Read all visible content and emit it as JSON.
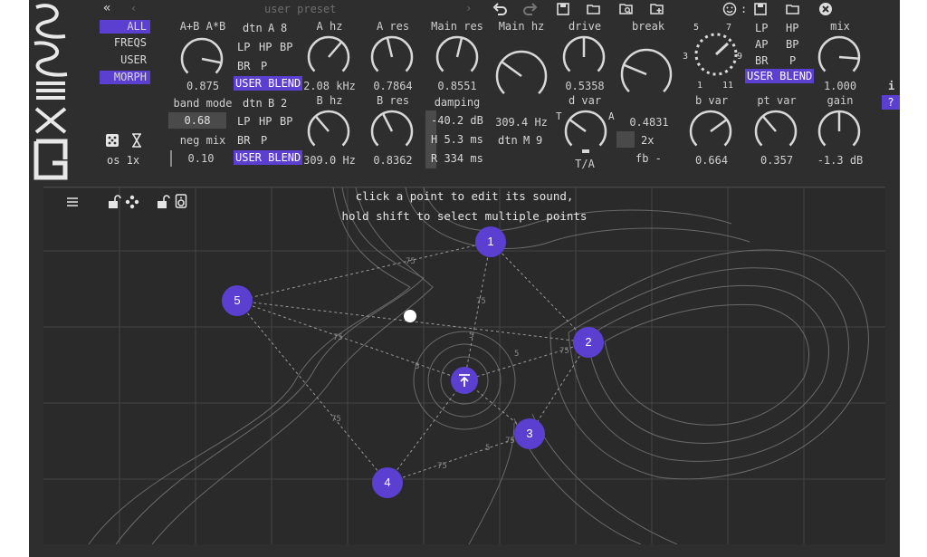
{
  "toolbar": {
    "preset_name": "user preset",
    "icons": [
      "double-chevron-left-icon",
      "chevron-left-icon",
      "chevron-right-icon",
      "undo-icon",
      "redo-icon",
      "save-icon",
      "folder-open-icon",
      "browse-presets-icon",
      "new-preset-icon",
      "smiley-icon",
      "save-icon",
      "folder-open-icon",
      "close-circle-icon"
    ],
    "smiley_sep": ":"
  },
  "modes": {
    "all": "ALL",
    "freqs": "FREQS",
    "user": "USER",
    "morph": "MORPH",
    "selected": "MORPH"
  },
  "osc": {
    "oversample": "os 1x",
    "icons": [
      "dice-icon",
      "hourglass-icon"
    ]
  },
  "blend": {
    "title": "A+B A*B",
    "value": "0.875",
    "band_mode_label": "band mode",
    "band_mode_value": "0.68",
    "neg_mix_label": "neg mix",
    "neg_mix_value": "0.10",
    "knob": 0.875
  },
  "filter_a": {
    "dtn": "dtn",
    "dtn_letter": "A",
    "dtn_value": "8",
    "types": [
      "LP",
      "HP",
      "BP",
      "BR",
      "P"
    ],
    "user_blend": "USER BLEND"
  },
  "filter_b": {
    "dtn": "dtn",
    "dtn_letter": "B",
    "dtn_value": "2",
    "types": [
      "LP",
      "HP",
      "BP",
      "BR",
      "P"
    ],
    "user_blend": "USER BLEND"
  },
  "a_hz": {
    "label": "A hz",
    "value": "2.08 kHz",
    "knob": 0.65
  },
  "a_res": {
    "label": "A res",
    "value": "0.7864",
    "knob": 0.45
  },
  "b_hz": {
    "label": "B hz",
    "value": "309.0 Hz",
    "knob": 0.35
  },
  "b_res": {
    "label": "B res",
    "value": "0.8362",
    "knob": 0.4
  },
  "main_res": {
    "label": "Main res",
    "value": "0.8551",
    "knob": 0.55
  },
  "damping": {
    "label": "damping",
    "db": "-40.2 dB",
    "h": "H 5.3 ms",
    "r": "R 334 ms"
  },
  "main_hz": {
    "label": "Main hz",
    "value": "309.4 Hz",
    "dtn": "dtn",
    "dtn_mode": "M",
    "dtn_value": "9",
    "knob": 0.3
  },
  "drive": {
    "label": "drive",
    "value": "0.5358",
    "knob": 0.5
  },
  "d_var": {
    "label": "d var",
    "t_left": "T",
    "a_right": "A",
    "footer": "T/A",
    "knob": 0.3
  },
  "break": {
    "label": "break",
    "value": "0.4831",
    "mult": "2x",
    "fb": "fb -",
    "knob": 0.25
  },
  "step": {
    "labels": [
      "5",
      "7",
      "3",
      "9",
      "1",
      "11"
    ],
    "knob": 0.6
  },
  "filter_c": {
    "types": [
      "LP",
      "HP",
      "AP",
      "BP",
      "BR",
      "P"
    ],
    "user_blend": "USER BLEND"
  },
  "mix": {
    "label": "mix",
    "value": "1.000",
    "knob": 0.85
  },
  "b_var": {
    "label": "b var",
    "value": "0.664",
    "knob": 0.7
  },
  "pt_var": {
    "label": "pt var",
    "value": "0.357",
    "knob": 0.35
  },
  "gain": {
    "label": "gain",
    "value": "-1.3 dB",
    "knob": 0.5
  },
  "side": {
    "info": "i",
    "help": "?"
  },
  "plot": {
    "hint1": "click a point to edit its sound,",
    "hint2": "hold shift to select multiple points",
    "icons": [
      "menu-icon",
      "lock-open-icon",
      "move-dots-icon",
      "lock-open-icon",
      "speaker-icon"
    ],
    "points": [
      "1",
      "2",
      "3",
      "4",
      "5"
    ],
    "contour_label": "75",
    "contour_small": "5",
    "accent": "#5b3fd1"
  }
}
